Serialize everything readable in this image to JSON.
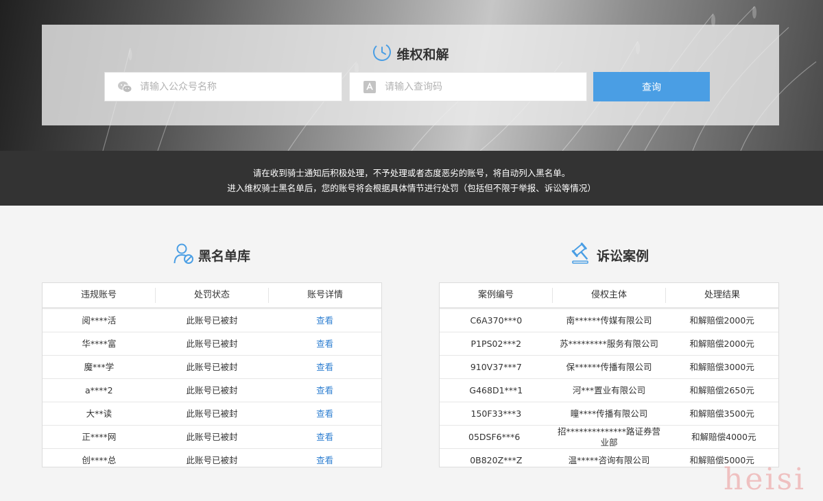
{
  "hero": {
    "title": "维权和解",
    "account_placeholder": "请输入公众号名称",
    "code_placeholder": "请输入查询码",
    "query_label": "查询"
  },
  "notice": {
    "line1": "请在收到骑士通知后积极处理，不予处理或者态度恶劣的账号，将自动列入黑名单。",
    "line2": "进入维权骑士黑名单后，您的账号将会根据具体情节进行处罚（包括但不限于举报、诉讼等情况）"
  },
  "blacklist": {
    "title": "黑名单库",
    "headers": [
      "违规账号",
      "处罚状态",
      "账号详情"
    ],
    "rows": [
      {
        "account": "阅****活",
        "status": "此账号已被封",
        "detail": "查看"
      },
      {
        "account": "华****富",
        "status": "此账号已被封",
        "detail": "查看"
      },
      {
        "account": "魔***学",
        "status": "此账号已被封",
        "detail": "查看"
      },
      {
        "account": "a****2",
        "status": "此账号已被封",
        "detail": "查看"
      },
      {
        "account": "大**读",
        "status": "此账号已被封",
        "detail": "查看"
      },
      {
        "account": "正****网",
        "status": "此账号已被封",
        "detail": "查看"
      },
      {
        "account": "创****总",
        "status": "此账号已被封",
        "detail": "查看"
      }
    ]
  },
  "cases": {
    "title": "诉讼案例",
    "headers": [
      "案例编号",
      "侵权主体",
      "处理结果"
    ],
    "rows": [
      {
        "id": "C6A370***0",
        "subject": "南******传媒有限公司",
        "result": "和解赔偿2000元"
      },
      {
        "id": "P1PS02***2",
        "subject": "苏*********服务有限公司",
        "result": "和解赔偿2000元"
      },
      {
        "id": "910V37***7",
        "subject": "保******传播有限公司",
        "result": "和解赔偿3000元"
      },
      {
        "id": "G468D1***1",
        "subject": "河***置业有限公司",
        "result": "和解赔偿2650元"
      },
      {
        "id": "150F33***3",
        "subject": "瞳****传播有限公司",
        "result": "和解赔偿3500元"
      },
      {
        "id": "05DSF6***6",
        "subject": "招**************路证券营业部",
        "result": "和解赔偿4000元"
      },
      {
        "id": "0B820Z***Z",
        "subject": "温*****咨询有限公司",
        "result": "和解赔偿5000元"
      }
    ]
  },
  "watermark": "heisi",
  "icons": {
    "title": "clock-icon",
    "account": "wechat-icon",
    "code": "code-icon",
    "blacklist": "user-ban-icon",
    "cases": "gavel-icon"
  },
  "colors": {
    "accent": "#4a9ee4",
    "link": "#2f7fd1",
    "notice_bg": "#333333"
  }
}
